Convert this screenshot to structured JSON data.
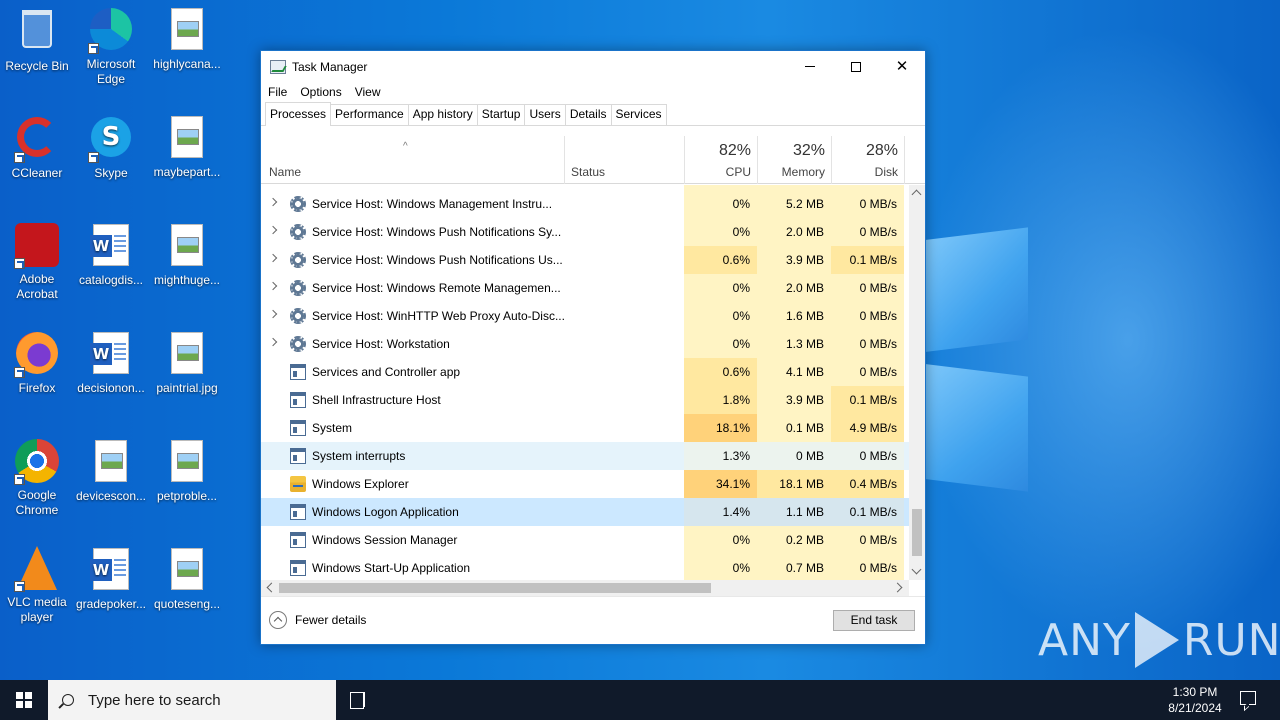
{
  "desktop": {
    "icons": [
      {
        "label": "Recycle Bin",
        "icon": "recycle-bin-icon"
      },
      {
        "label": "Microsoft Edge",
        "icon": "edge-icon"
      },
      {
        "label": "highlycana...",
        "icon": "image-file-icon"
      },
      {
        "label": "CCleaner",
        "icon": "ccleaner-icon"
      },
      {
        "label": "Skype",
        "icon": "skype-icon"
      },
      {
        "label": "maybepart...",
        "icon": "image-file-icon"
      },
      {
        "label": "Adobe Acrobat",
        "icon": "acrobat-icon"
      },
      {
        "label": "catalogdis...",
        "icon": "word-doc-icon"
      },
      {
        "label": "mighthuge...",
        "icon": "image-file-icon"
      },
      {
        "label": "Firefox",
        "icon": "firefox-icon"
      },
      {
        "label": "decisionon...",
        "icon": "word-doc-icon"
      },
      {
        "label": "paintrial.jpg",
        "icon": "image-file-icon"
      },
      {
        "label": "Google Chrome",
        "icon": "chrome-icon"
      },
      {
        "label": "devicescon...",
        "icon": "image-file-icon"
      },
      {
        "label": "petproble...",
        "icon": "image-file-icon"
      },
      {
        "label": "VLC media player",
        "icon": "vlc-icon"
      },
      {
        "label": "gradepoker...",
        "icon": "word-doc-icon"
      },
      {
        "label": "quoteseng...",
        "icon": "image-file-icon"
      }
    ],
    "watermark": {
      "left": "ANY",
      "right": "RUN"
    }
  },
  "task_manager": {
    "title": "Task Manager",
    "menu": [
      "File",
      "Options",
      "View"
    ],
    "tabs": [
      "Processes",
      "Performance",
      "App history",
      "Startup",
      "Users",
      "Details",
      "Services"
    ],
    "active_tab": "Processes",
    "columns": {
      "name": "Name",
      "status": "Status",
      "cpu": {
        "pct": "82%",
        "label": "CPU"
      },
      "memory": {
        "pct": "32%",
        "label": "Memory"
      },
      "disk": {
        "pct": "28%",
        "label": "Disk"
      }
    },
    "rows": [
      {
        "name": "Service Host: Windows Management Instru...",
        "cpu": "0%",
        "mem": "5.2 MB",
        "disk": "0 MB/s",
        "expandable": true,
        "icon": "gear-icon"
      },
      {
        "name": "Service Host: Windows Push Notifications Sy...",
        "cpu": "0%",
        "mem": "2.0 MB",
        "disk": "0 MB/s",
        "expandable": true,
        "icon": "gear-icon"
      },
      {
        "name": "Service Host: Windows Push Notifications Us...",
        "cpu": "0.6%",
        "mem": "3.9 MB",
        "disk": "0.1 MB/s",
        "expandable": true,
        "icon": "gear-icon"
      },
      {
        "name": "Service Host: Windows Remote Managemen...",
        "cpu": "0%",
        "mem": "2.0 MB",
        "disk": "0 MB/s",
        "expandable": true,
        "icon": "gear-icon"
      },
      {
        "name": "Service Host: WinHTTP Web Proxy Auto-Disc...",
        "cpu": "0%",
        "mem": "1.6 MB",
        "disk": "0 MB/s",
        "expandable": true,
        "icon": "gear-icon"
      },
      {
        "name": "Service Host: Workstation",
        "cpu": "0%",
        "mem": "1.3 MB",
        "disk": "0 MB/s",
        "expandable": true,
        "icon": "gear-icon"
      },
      {
        "name": "Services and Controller app",
        "cpu": "0.6%",
        "mem": "4.1 MB",
        "disk": "0 MB/s",
        "expandable": false,
        "icon": "app-window-icon"
      },
      {
        "name": "Shell Infrastructure Host",
        "cpu": "1.8%",
        "mem": "3.9 MB",
        "disk": "0.1 MB/s",
        "expandable": false,
        "icon": "app-window-icon"
      },
      {
        "name": "System",
        "cpu": "18.1%",
        "mem": "0.1 MB",
        "disk": "4.9 MB/s",
        "expandable": false,
        "icon": "app-window-icon"
      },
      {
        "name": "System interrupts",
        "cpu": "1.3%",
        "mem": "0 MB",
        "disk": "0 MB/s",
        "expandable": false,
        "icon": "app-window-icon",
        "state": "hover"
      },
      {
        "name": "Windows Explorer",
        "cpu": "34.1%",
        "mem": "18.1 MB",
        "disk": "0.4 MB/s",
        "expandable": false,
        "icon": "folder-icon"
      },
      {
        "name": "Windows Logon Application",
        "cpu": "1.4%",
        "mem": "1.1 MB",
        "disk": "0.1 MB/s",
        "expandable": false,
        "icon": "app-window-icon",
        "state": "selected"
      },
      {
        "name": "Windows Session Manager",
        "cpu": "0%",
        "mem": "0.2 MB",
        "disk": "0 MB/s",
        "expandable": false,
        "icon": "app-window-icon"
      },
      {
        "name": "Windows Start-Up Application",
        "cpu": "0%",
        "mem": "0.7 MB",
        "disk": "0 MB/s",
        "expandable": false,
        "icon": "app-window-icon"
      }
    ],
    "fewer_details": "Fewer details",
    "end_task": "End task"
  },
  "taskbar": {
    "search_placeholder": "Type here to search",
    "time": "1:30 PM",
    "date": "8/21/2024"
  },
  "colors": {
    "heat_low": "#fff4c4",
    "heat_mid": "#ffe8a0",
    "heat_high": "#ffd27a",
    "selected_row": "#cce8ff",
    "hover_row": "#e5f3fb"
  }
}
